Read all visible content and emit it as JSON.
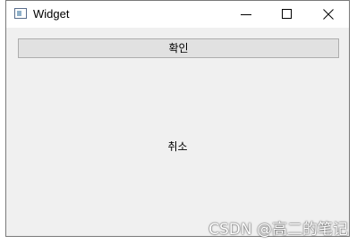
{
  "window": {
    "title": "Widget",
    "icon": "app-window-icon"
  },
  "titlebar": {
    "minimize_icon": "minimize-icon",
    "maximize_icon": "maximize-icon",
    "close_icon": "close-icon"
  },
  "content": {
    "confirm_label": "확인",
    "cancel_label": "취소"
  },
  "watermark": {
    "text": "CSDN @高二的笔记"
  },
  "colors": {
    "titlebar_bg": "#ffffff",
    "client_bg": "#f0f0f0",
    "button_bg": "#e1e1e1",
    "button_border": "#adadad",
    "window_border": "#7a7a7a"
  }
}
